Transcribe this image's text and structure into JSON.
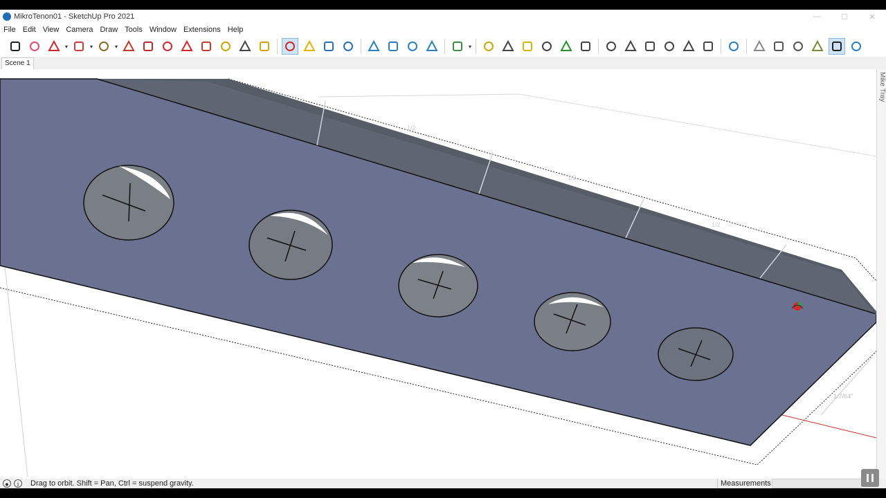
{
  "window": {
    "title": "MikroTenon01 - SketchUp Pro 2021",
    "controls": {
      "minimize": "—",
      "maximize": "☐",
      "close": "✕"
    }
  },
  "menu": [
    "File",
    "Edit",
    "View",
    "Camera",
    "Draw",
    "Tools",
    "Window",
    "Extensions",
    "Help"
  ],
  "toolbar": {
    "tools": [
      {
        "name": "select-tool",
        "icon": "arrow-icon",
        "color": "#222222"
      },
      {
        "name": "eraser-tool",
        "icon": "eraser-icon",
        "color": "#e24b6e"
      },
      {
        "name": "pencil-tool",
        "icon": "pencil-icon",
        "color": "#cc2a2a",
        "caret": true
      },
      {
        "name": "arc-tool",
        "icon": "arc-icon",
        "color": "#d23b3b",
        "caret": true
      },
      {
        "name": "circle-tool",
        "icon": "circle-icon",
        "color": "#8a6a2a",
        "caret": true
      },
      {
        "name": "push-pull-tool",
        "icon": "push-pull-icon",
        "color": "#c23b2b"
      },
      {
        "name": "follow-me-tool",
        "icon": "follow-me-icon",
        "color": "#c2272d"
      },
      {
        "name": "move-tool",
        "icon": "move-icon",
        "color": "#d22a2a"
      },
      {
        "name": "rotate-tool",
        "icon": "rotate-icon",
        "color": "#d22a2a"
      },
      {
        "name": "scale-tool",
        "icon": "scale-icon",
        "color": "#c23b2b"
      },
      {
        "name": "tape-measure-tool",
        "icon": "tape-icon",
        "color": "#c9a600"
      },
      {
        "name": "text-tool",
        "icon": "text-icon",
        "color": "#444444"
      },
      {
        "name": "paint-bucket-tool",
        "icon": "paint-icon",
        "color": "#d8a400"
      },
      {
        "name": "orbit-tool",
        "icon": "orbit-icon",
        "color": "#d22a2a",
        "active": true
      },
      {
        "name": "pan-tool",
        "icon": "hand-icon",
        "color": "#e7b400"
      },
      {
        "name": "zoom-tool",
        "icon": "magnifier-icon",
        "color": "#2a6fb5"
      },
      {
        "name": "zoom-extents-tool",
        "icon": "zoom-extents-icon",
        "color": "#2a6fb5"
      },
      {
        "name": "xray-tool",
        "icon": "target-icon",
        "color": "#2a7fc2"
      },
      {
        "name": "section-plane-tool",
        "icon": "section-icon",
        "color": "#2a7fc2"
      },
      {
        "name": "section-display-tool",
        "icon": "layers-icon",
        "color": "#2a7fc2"
      },
      {
        "name": "section-cuts-tool",
        "icon": "section-cut-icon",
        "color": "#2a7fc2"
      },
      {
        "name": "geo-tool",
        "icon": "globe-icon",
        "color": "#3a8f3a",
        "caret": true
      },
      {
        "name": "dimension-tool",
        "icon": "dimension-icon",
        "color": "#c9a600"
      },
      {
        "name": "protractor-tool",
        "icon": "protractor-icon",
        "color": "#444444"
      },
      {
        "name": "measure-tool",
        "icon": "ruler-icon",
        "color": "#d8b400"
      },
      {
        "name": "3d-text-tool",
        "icon": "text-3d-icon",
        "color": "#444444"
      },
      {
        "name": "axes-tool",
        "icon": "axes-icon",
        "color": "#2a8f2a"
      },
      {
        "name": "walk-tool",
        "icon": "walk-icon",
        "color": "#444444"
      },
      {
        "name": "iso-view",
        "icon": "iso-house-icon",
        "color": "#444444"
      },
      {
        "name": "top-view",
        "icon": "top-house-icon",
        "color": "#444444"
      },
      {
        "name": "front-view",
        "icon": "front-house-icon",
        "color": "#444444"
      },
      {
        "name": "right-view",
        "icon": "right-house-icon",
        "color": "#444444"
      },
      {
        "name": "back-view",
        "icon": "back-house-icon",
        "color": "#444444"
      },
      {
        "name": "left-view",
        "icon": "left-house-icon",
        "color": "#444444"
      },
      {
        "name": "xray-style",
        "icon": "cube-xray-icon",
        "color": "#2a7fc2"
      },
      {
        "name": "back-edges-style",
        "icon": "cube-back-icon",
        "color": "#888888"
      },
      {
        "name": "wireframe-style",
        "icon": "cube-wire-icon",
        "color": "#555555"
      },
      {
        "name": "hidden-line-style",
        "icon": "cube-hidden-icon",
        "color": "#555555"
      },
      {
        "name": "shaded-style",
        "icon": "cube-shaded-icon",
        "color": "#7a8a3a"
      },
      {
        "name": "shaded-textures-style",
        "icon": "cube-texture-icon",
        "color": "#222222",
        "active": true
      },
      {
        "name": "monochrome-style",
        "icon": "cube-mono-icon",
        "color": "#2a7fc2"
      }
    ]
  },
  "scenes": {
    "tabs": [
      "Scene 1"
    ]
  },
  "tray": {
    "label": "Mike Tray"
  },
  "viewport": {
    "dimension_labels": [
      "1/2",
      "1/2",
      "1/2",
      "1/2",
      "1/2",
      "1/2",
      "1/7/64\""
    ],
    "colors": {
      "board": "#6b7190",
      "hole": "#7a7f86",
      "edge": "#111111",
      "bg": "#ffffff",
      "axis_red": "#c83030"
    }
  },
  "status": {
    "message": "Drag to orbit. Shift = Pan, Ctrl = suspend gravity.",
    "measurements_label": "Measurements",
    "measurements_value": ""
  }
}
